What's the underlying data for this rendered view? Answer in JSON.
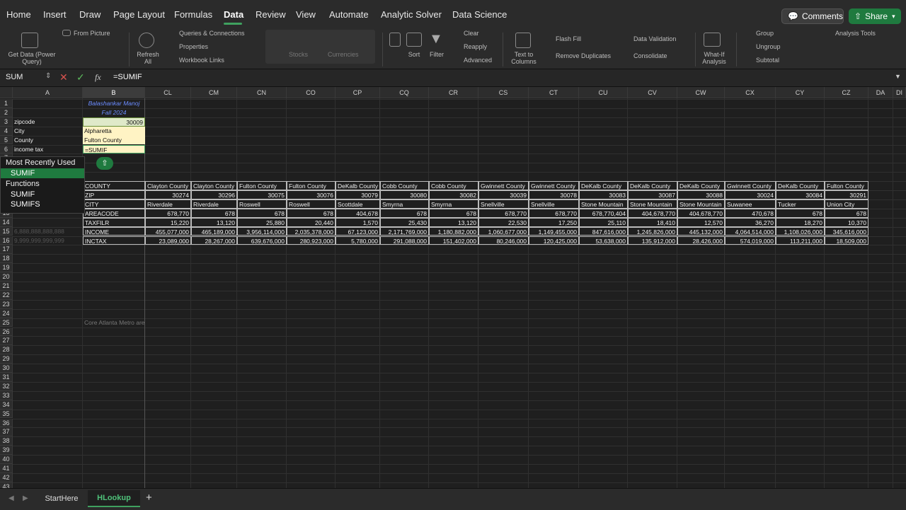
{
  "ribbon_tabs": [
    "Home",
    "Insert",
    "Draw",
    "Page Layout",
    "Formulas",
    "Data",
    "Review",
    "View",
    "Automate",
    "Analytic Solver",
    "Data Science"
  ],
  "active_tab": "Data",
  "comments_label": "Comments",
  "share_label": "Share",
  "ribbon": {
    "get_data": "Get Data (Power Query)",
    "from_picture": "From Picture",
    "refresh_all": "Refresh All",
    "queries": "Queries & Connections",
    "properties": "Properties",
    "workbook_links": "Workbook Links",
    "stocks": "Stocks",
    "currencies": "Currencies",
    "sort": "Sort",
    "filter": "Filter",
    "clear": "Clear",
    "reapply": "Reapply",
    "advanced": "Advanced",
    "text_to_columns": "Text to Columns",
    "flash_fill": "Flash Fill",
    "remove_duplicates": "Remove Duplicates",
    "data_validation": "Data Validation",
    "consolidate": "Consolidate",
    "what_if": "What-If Analysis",
    "group": "Group",
    "ungroup": "Ungroup",
    "subtotal": "Subtotal",
    "analysis_tools": "Analysis Tools"
  },
  "formula_bar": {
    "name_box": "SUM",
    "fx": "fx",
    "formula": "=SUMIF"
  },
  "columns": [
    "A",
    "B",
    "CL",
    "CM",
    "CN",
    "CO",
    "CP",
    "CQ",
    "CR",
    "CS",
    "CT",
    "CU",
    "CV",
    "CW",
    "CX",
    "CY",
    "CZ",
    "DA",
    "DI"
  ],
  "selected_column": "B",
  "rows": [
    "1",
    "2",
    "3",
    "4",
    "5",
    "6",
    "7",
    "8",
    "9",
    "10",
    "11",
    "12",
    "13",
    "14",
    "15",
    "16",
    "17",
    "18",
    "19",
    "20",
    "21",
    "22",
    "23",
    "24",
    "25",
    "26",
    "27",
    "28",
    "29",
    "30",
    "31",
    "32",
    "33",
    "34",
    "35",
    "36",
    "37",
    "38",
    "39",
    "40",
    "41",
    "42",
    "43"
  ],
  "header_cells": {
    "b1": "Balashankar Manoj",
    "b2": "Fall 2024",
    "a3": "zipcode",
    "b3": "30009",
    "a4": "City",
    "b4": "Alpharetta",
    "a5": "County",
    "b5": "Fulton County",
    "a6": "income tax",
    "b6": "=SUMIF",
    "a15_faded": "6,888,888,888,888",
    "a16_faded": "9,999,999,999,999",
    "b25": "Core Atlanta Metro are"
  },
  "table": {
    "row_labels": [
      "COUNTY",
      "ZIP",
      "CITY",
      "AREACODE",
      "TAXFILR",
      "INCOME",
      "INCTAX"
    ],
    "columns": [
      {
        "county": "Clayton County",
        "zip": "30274",
        "city": "Riverdale",
        "areacode": "678,770",
        "taxfilr": "15,220",
        "income": "455,077,000",
        "inctax": "23,089,000"
      },
      {
        "county": "Clayton County",
        "zip": "30296",
        "city": "Riverdale",
        "areacode": "678",
        "taxfilr": "13,120",
        "income": "465,189,000",
        "inctax": "28,267,000"
      },
      {
        "county": "Fulton County",
        "zip": "30075",
        "city": "Roswell",
        "areacode": "678",
        "taxfilr": "25,880",
        "income": "3,956,114,000",
        "inctax": "639,676,000"
      },
      {
        "county": "Fulton County",
        "zip": "30076",
        "city": "Roswell",
        "areacode": "678",
        "taxfilr": "20,440",
        "income": "2,035,378,000",
        "inctax": "280,923,000"
      },
      {
        "county": "DeKalb County",
        "zip": "30079",
        "city": "Scottdale",
        "areacode": "404,678",
        "taxfilr": "1,570",
        "income": "67,123,000",
        "inctax": "5,780,000"
      },
      {
        "county": "Cobb County",
        "zip": "30080",
        "city": "Smyrna",
        "areacode": "678",
        "taxfilr": "25,430",
        "income": "2,171,769,000",
        "inctax": "291,088,000"
      },
      {
        "county": "Cobb County",
        "zip": "30082",
        "city": "Smyrna",
        "areacode": "678",
        "taxfilr": "13,120",
        "income": "1,180,882,000",
        "inctax": "151,402,000"
      },
      {
        "county": "Gwinnett County",
        "zip": "30039",
        "city": "Snellville",
        "areacode": "678,770",
        "taxfilr": "22,530",
        "income": "1,060,677,000",
        "inctax": "80,246,000"
      },
      {
        "county": "Gwinnett County",
        "zip": "30078",
        "city": "Snellville",
        "areacode": "678,770",
        "taxfilr": "17,250",
        "income": "1,149,455,000",
        "inctax": "120,425,000"
      },
      {
        "county": "DeKalb County",
        "zip": "30083",
        "city": "Stone Mountain",
        "areacode": "678,770,404",
        "taxfilr": "25,110",
        "income": "847,616,000",
        "inctax": "53,638,000"
      },
      {
        "county": "DeKalb County",
        "zip": "30087",
        "city": "Stone Mountain",
        "areacode": "404,678,770",
        "taxfilr": "18,410",
        "income": "1,245,826,000",
        "inctax": "135,912,000"
      },
      {
        "county": "DeKalb County",
        "zip": "30088",
        "city": "Stone Mountain",
        "areacode": "404,678,770",
        "taxfilr": "12,570",
        "income": "445,132,000",
        "inctax": "28,426,000"
      },
      {
        "county": "Gwinnett County",
        "zip": "30024",
        "city": "Suwanee",
        "areacode": "470,678",
        "taxfilr": "36,270",
        "income": "4,064,514,000",
        "inctax": "574,019,000"
      },
      {
        "county": "DeKalb County",
        "zip": "30084",
        "city": "Tucker",
        "areacode": "678",
        "taxfilr": "18,270",
        "income": "1,108,026,000",
        "inctax": "113,211,000"
      },
      {
        "county": "Fulton County",
        "zip": "30291",
        "city": "Union City",
        "areacode": "678",
        "taxfilr": "10,370",
        "income": "345,616,000",
        "inctax": "18,509,000"
      }
    ]
  },
  "autocomplete": {
    "section1": "Most Recently Used",
    "item1": "SUMIF",
    "section2": "Functions",
    "item2": "SUMIF",
    "item3": "SUMIFS"
  },
  "sheet_tabs": [
    "StartHere",
    "HLookup"
  ],
  "active_sheet": "HLookup",
  "add_sheet": "+"
}
